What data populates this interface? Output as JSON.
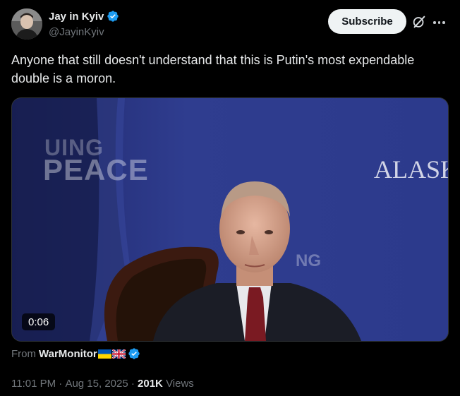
{
  "author": {
    "display_name": "Jay in Kyiv",
    "handle": "@JayinKyiv",
    "verified": true,
    "avatar_icon": "user-avatar"
  },
  "header_actions": {
    "subscribe_label": "Subscribe",
    "grok_icon": "grok-icon",
    "more_icon": "more-icon"
  },
  "tweet": {
    "text": "Anyone that still doesn't understand that this is Putin's most expendable double is a moron."
  },
  "media": {
    "backdrop_text_line1": "UING",
    "backdrop_text_line2": "PEACE",
    "backdrop_text_right": "ALASKA",
    "backdrop_text_lower": "NG",
    "duration": "0:06"
  },
  "source": {
    "prefix": "From",
    "name": "WarMonitor",
    "flags": [
      "ukraine-flag",
      "uk-flag"
    ],
    "verified": true
  },
  "meta": {
    "time": "11:01 PM",
    "date": "Aug 15, 2025",
    "separator": " · ",
    "views_count": "201K",
    "views_label": "Views"
  },
  "colors": {
    "background": "#000000",
    "text_primary": "#e7e9ea",
    "text_secondary": "#71767b",
    "verified_blue": "#1d9bf0",
    "subscribe_bg": "#eff3f4",
    "video_backdrop": "#2a3578"
  }
}
